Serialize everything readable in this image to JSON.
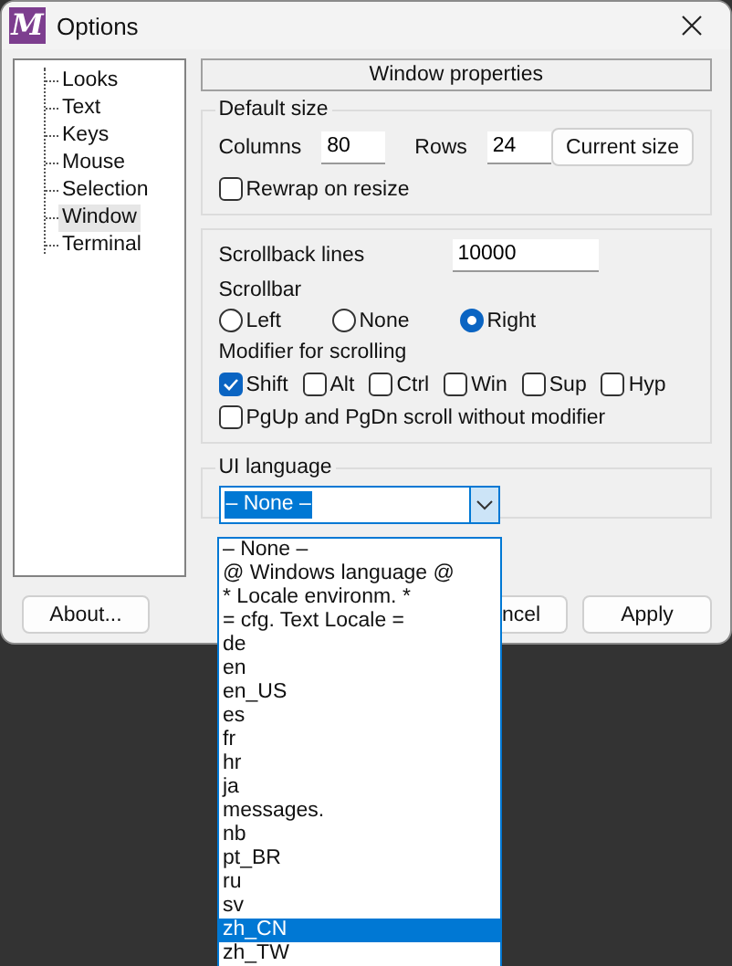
{
  "window": {
    "logo_letter": "M",
    "title": "Options"
  },
  "tree": {
    "items": [
      {
        "label": "Looks",
        "selected": false
      },
      {
        "label": "Text",
        "selected": false
      },
      {
        "label": "Keys",
        "selected": false
      },
      {
        "label": "Mouse",
        "selected": false
      },
      {
        "label": "Selection",
        "selected": false
      },
      {
        "label": "Window",
        "selected": true
      },
      {
        "label": "Terminal",
        "selected": false
      }
    ]
  },
  "section_header": "Window properties",
  "default_size": {
    "title": "Default size",
    "columns_label": "Columns",
    "columns_value": "80",
    "rows_label": "Rows",
    "rows_value": "24",
    "current_size_button": "Current size",
    "rewrap": {
      "label": "Rewrap on resize",
      "checked": false
    }
  },
  "scrolling": {
    "scrollback_label": "Scrollback lines",
    "scrollback_value": "10000",
    "scrollbar_label": "Scrollbar",
    "scrollbar_options": [
      {
        "label": "Left",
        "selected": false
      },
      {
        "label": "None",
        "selected": false
      },
      {
        "label": "Right",
        "selected": true
      }
    ],
    "modifier_label": "Modifier for scrolling",
    "modifiers": [
      {
        "label": "Shift",
        "checked": true
      },
      {
        "label": "Alt",
        "checked": false
      },
      {
        "label": "Ctrl",
        "checked": false
      },
      {
        "label": "Win",
        "checked": false
      },
      {
        "label": "Sup",
        "checked": false
      },
      {
        "label": "Hyp",
        "checked": false
      }
    ],
    "pgup": {
      "label": "PgUp and PgDn scroll without modifier",
      "checked": false
    }
  },
  "ui_language": {
    "title": "UI language",
    "value": "– None –",
    "options": [
      {
        "label": "– None –",
        "highlighted": false
      },
      {
        "label": "@ Windows language @",
        "highlighted": false
      },
      {
        "label": "* Locale environm. *",
        "highlighted": false
      },
      {
        "label": "= cfg. Text Locale =",
        "highlighted": false
      },
      {
        "label": "de",
        "highlighted": false
      },
      {
        "label": "en",
        "highlighted": false
      },
      {
        "label": "en_US",
        "highlighted": false
      },
      {
        "label": "es",
        "highlighted": false
      },
      {
        "label": "fr",
        "highlighted": false
      },
      {
        "label": "hr",
        "highlighted": false
      },
      {
        "label": "ja",
        "highlighted": false
      },
      {
        "label": "messages.",
        "highlighted": false
      },
      {
        "label": "nb",
        "highlighted": false
      },
      {
        "label": "pt_BR",
        "highlighted": false
      },
      {
        "label": "ru",
        "highlighted": false
      },
      {
        "label": "sv",
        "highlighted": false
      },
      {
        "label": "zh_CN",
        "highlighted": true
      },
      {
        "label": "zh_TW",
        "highlighted": false
      }
    ]
  },
  "buttons": {
    "about": "About...",
    "cancel": "ncel",
    "apply": "Apply"
  }
}
